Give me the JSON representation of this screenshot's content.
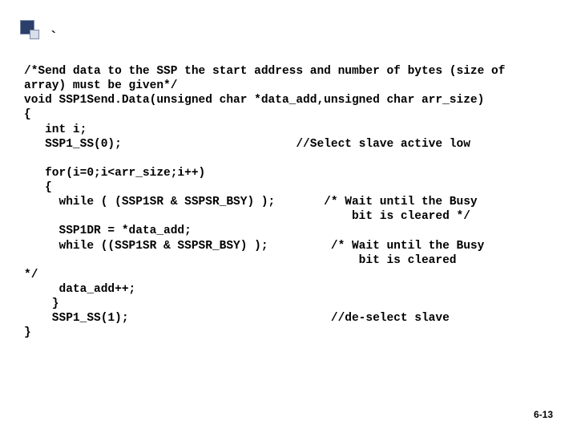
{
  "bullet_tick": "`",
  "code": "/*Send data to the SSP the start address and number of bytes (size of\narray) must be given*/\nvoid SSP1Send.Data(unsigned char *data_add,unsigned char arr_size)\n{\n   int i;\n   SSP1_SS(0);                         //Select slave active low\n\n   for(i=0;i<arr_size;i++)\n   {\n     while ( (SSP1SR & SSPSR_BSY) );       /* Wait until the Busy\n                                               bit is cleared */\n     SSP1DR = *data_add;\n     while ((SSP1SR & SSPSR_BSY) );         /* Wait until the Busy\n                                                bit is cleared\n*/\n     data_add++;\n    }\n    SSP1_SS(1);                             //de-select slave\n}",
  "page_number": "6-13"
}
